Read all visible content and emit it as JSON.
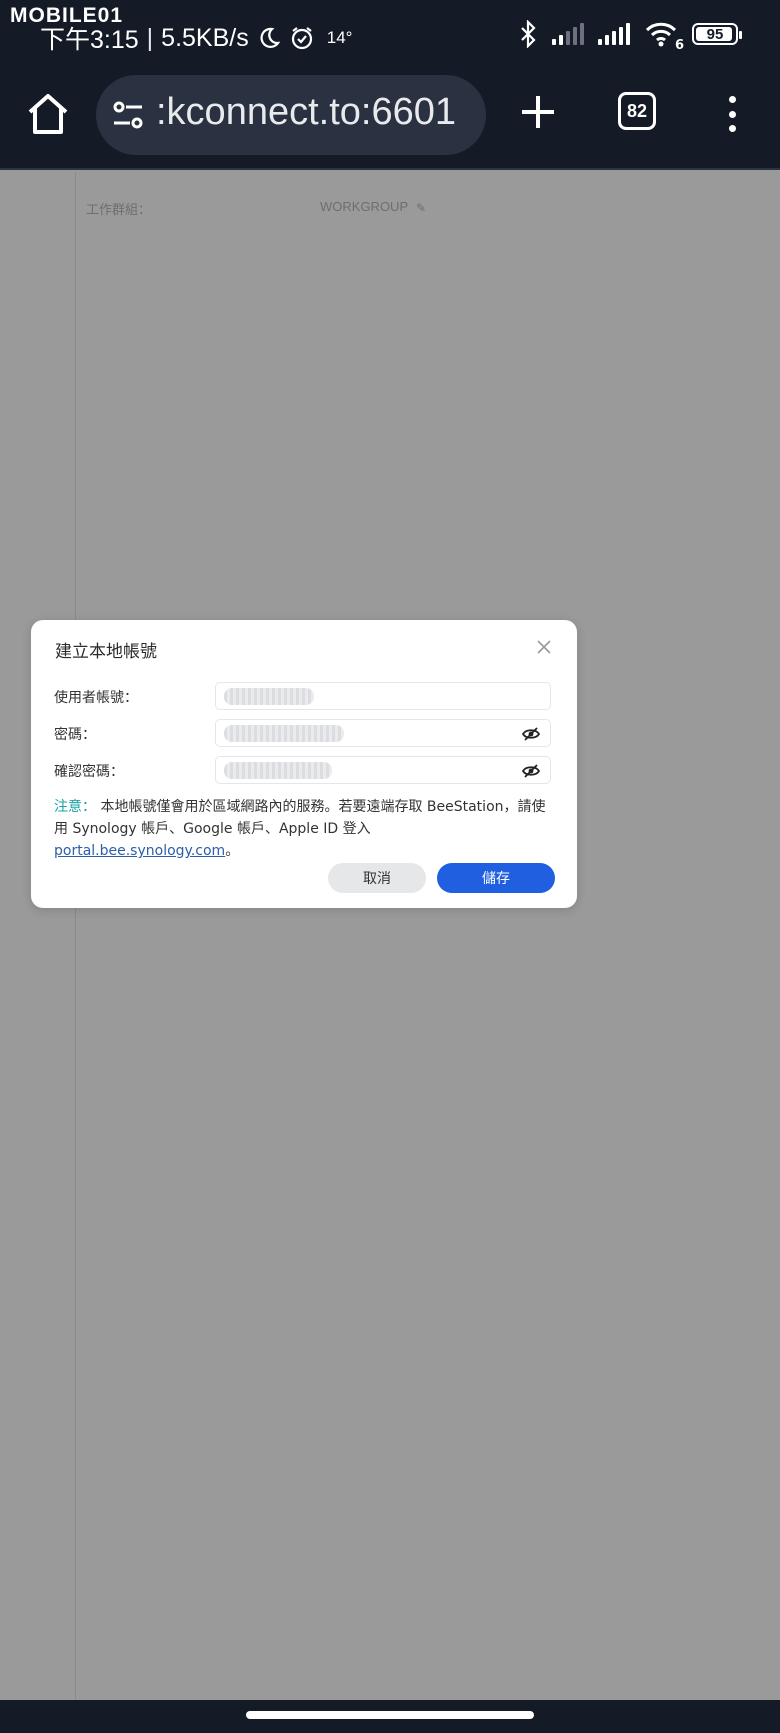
{
  "status_bar": {
    "watermark": "MOBILE01",
    "time": "下午3:15",
    "speed": "5.5KB/s",
    "temperature": "14°",
    "wifi_badge": "6",
    "battery": "95"
  },
  "browser": {
    "url": ":kconnect.to:6601",
    "tab_count": "82"
  },
  "background": {
    "workgroup_label": "工作群組：",
    "workgroup_value": "WORKGROUP"
  },
  "dialog": {
    "title": "建立本地帳號",
    "username_label": "使用者帳號：",
    "password_label": "密碼：",
    "confirm_label": "確認密碼：",
    "note_label": "注意：",
    "note_text_1": " 本地帳號僅會用於區域網路內的服務。若要遠端存取 BeeStation，請使用 Synology 帳戶、Google 帳戶、Apple ID 登入 ",
    "note_link": "portal.bee.synology.com",
    "note_text_2": "。",
    "cancel_label": "取消",
    "save_label": "儲存"
  }
}
